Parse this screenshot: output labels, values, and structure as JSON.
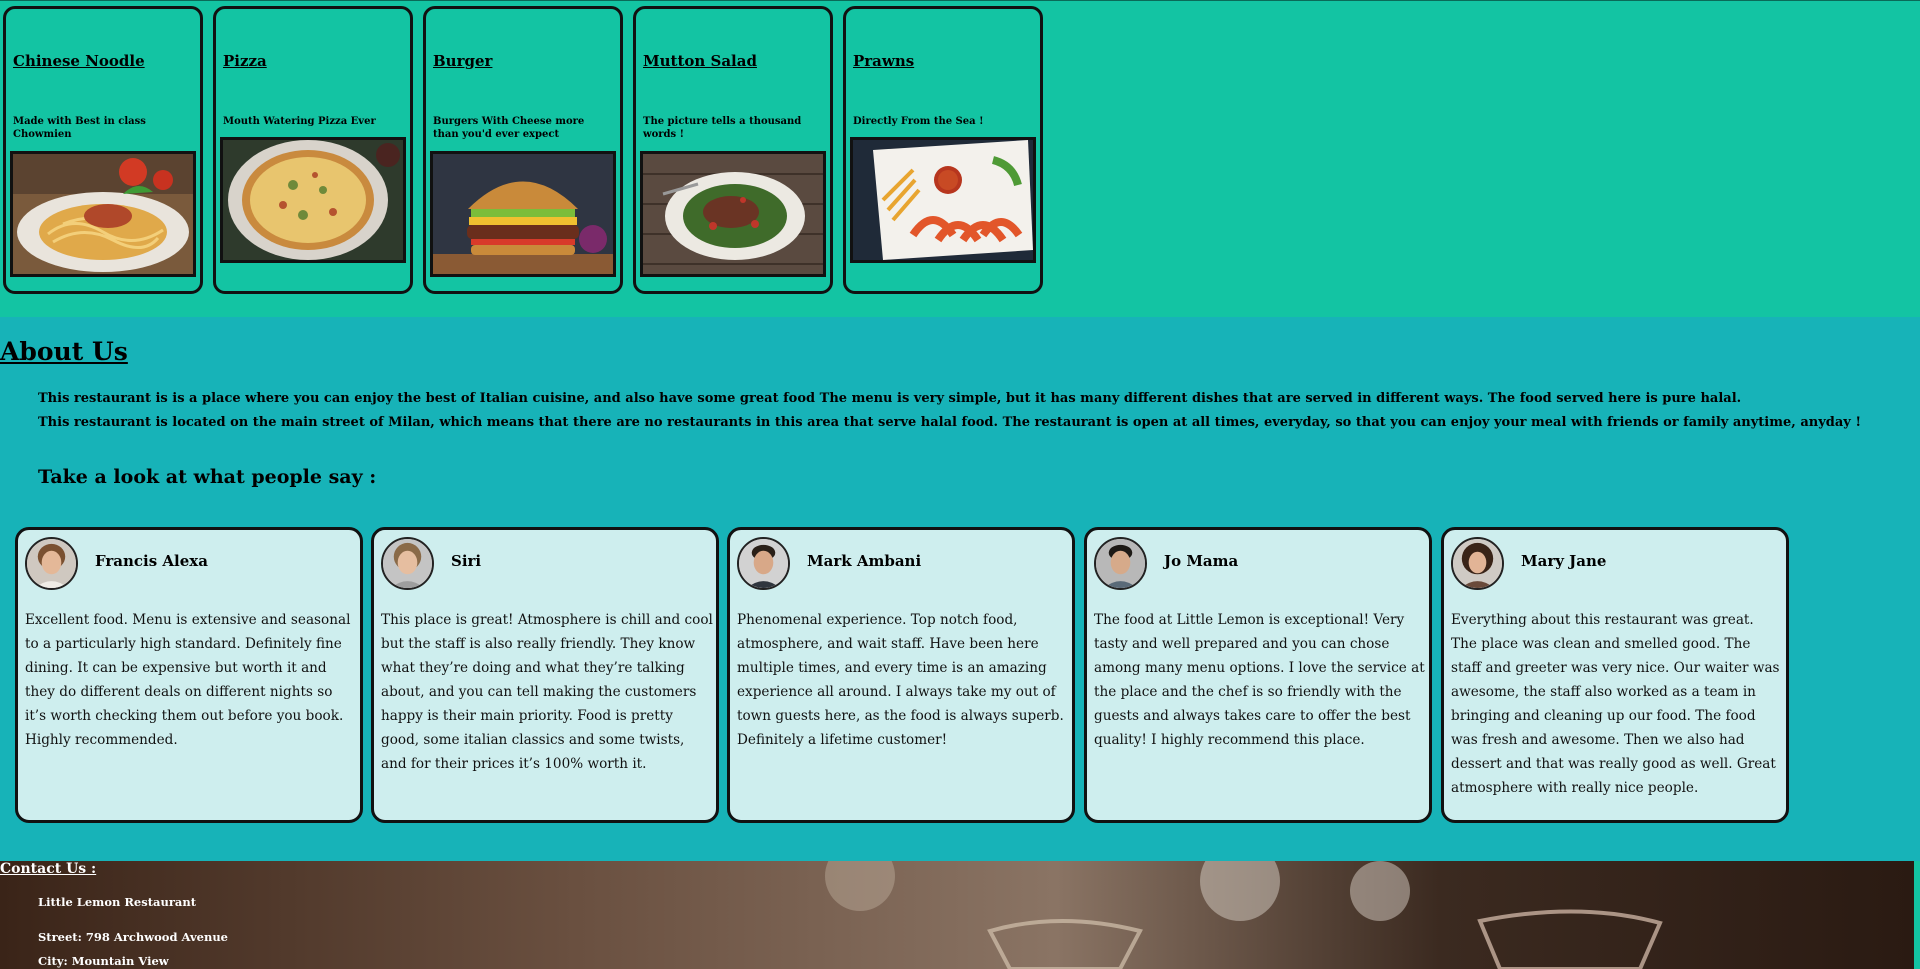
{
  "menu": {
    "items": [
      {
        "title": "Chinese Noodle",
        "description": "Made with Best in class Chowmien",
        "image_icon": "noodle-plate-image"
      },
      {
        "title": "Pizza",
        "description": "Mouth Watering Pizza Ever",
        "image_icon": "pizza-image"
      },
      {
        "title": "Burger",
        "description": "Burgers With Cheese more than you'd ever expect",
        "image_icon": "burger-image"
      },
      {
        "title": "Mutton Salad",
        "description": "The picture tells a thousand words !",
        "image_icon": "mutton-salad-image"
      },
      {
        "title": "Prawns",
        "description": "Directly From the Sea !",
        "image_icon": "prawns-plate-image"
      }
    ]
  },
  "about": {
    "title": "About Us",
    "paragraph1": "This restaurant is is a place where you can enjoy the best of Italian cuisine, and also have some great food The menu is very simple, but it has many different dishes that are served in different ways. The food served here is pure halal.",
    "paragraph2": "This restaurant is located on the main street of Milan, which means that there are no restaurants in this area that serve halal food. The restaurant is open at all times, everyday, so that you can enjoy your meal with friends or family anytime, anyday !",
    "reviews_heading": "Take a look at what people say :"
  },
  "reviews": [
    {
      "name": "Francis Alexa",
      "text": "Excellent food. Menu is extensive and seasonal to a particularly high standard. Definitely fine dining. It can be expensive but worth it and they do different deals on different nights so it’s worth checking them out before you book. Highly recommended."
    },
    {
      "name": "Siri",
      "text": "This place is great! Atmosphere is chill and cool but the staff is also really friendly. They know what they’re doing and what they’re talking about, and you can tell making the customers happy is their main priority. Food is pretty good, some italian classics and some twists, and for their prices it’s 100% worth it."
    },
    {
      "name": "Mark Ambani",
      "text": "Phenomenal experience. Top notch food, atmosphere, and wait staff. Have been here multiple times, and every time is an amazing experience all around. I always take my out of town guests here, as the food is always superb. Definitely a lifetime customer!"
    },
    {
      "name": "Jo Mama",
      "text": "The food at Little Lemon is exceptional! Very tasty and well prepared and you can chose among many menu options. I love the service at the place and the chef is so friendly with the guests and always takes care to offer the best quality! I highly recommend this place."
    },
    {
      "name": "Mary Jane",
      "text": "Everything about this restaurant was great. The place was clean and smelled good. The staff and greeter was very nice. Our waiter was awesome, the staff also worked as a team in bringing and cleaning up our food. The food was fresh and awesome. Then we also had dessert and that was really good as well. Great atmosphere with really nice people."
    }
  ],
  "contact": {
    "title": "Contact Us :",
    "name": "Little Lemon Restaurant",
    "street": "Street: 798 Archwood Avenue",
    "city": "City: Mountain View"
  },
  "colors": {
    "top_background": "#13c4a3",
    "about_background": "#17b3b8",
    "review_card": "#ceeeee",
    "border": "#111111"
  }
}
